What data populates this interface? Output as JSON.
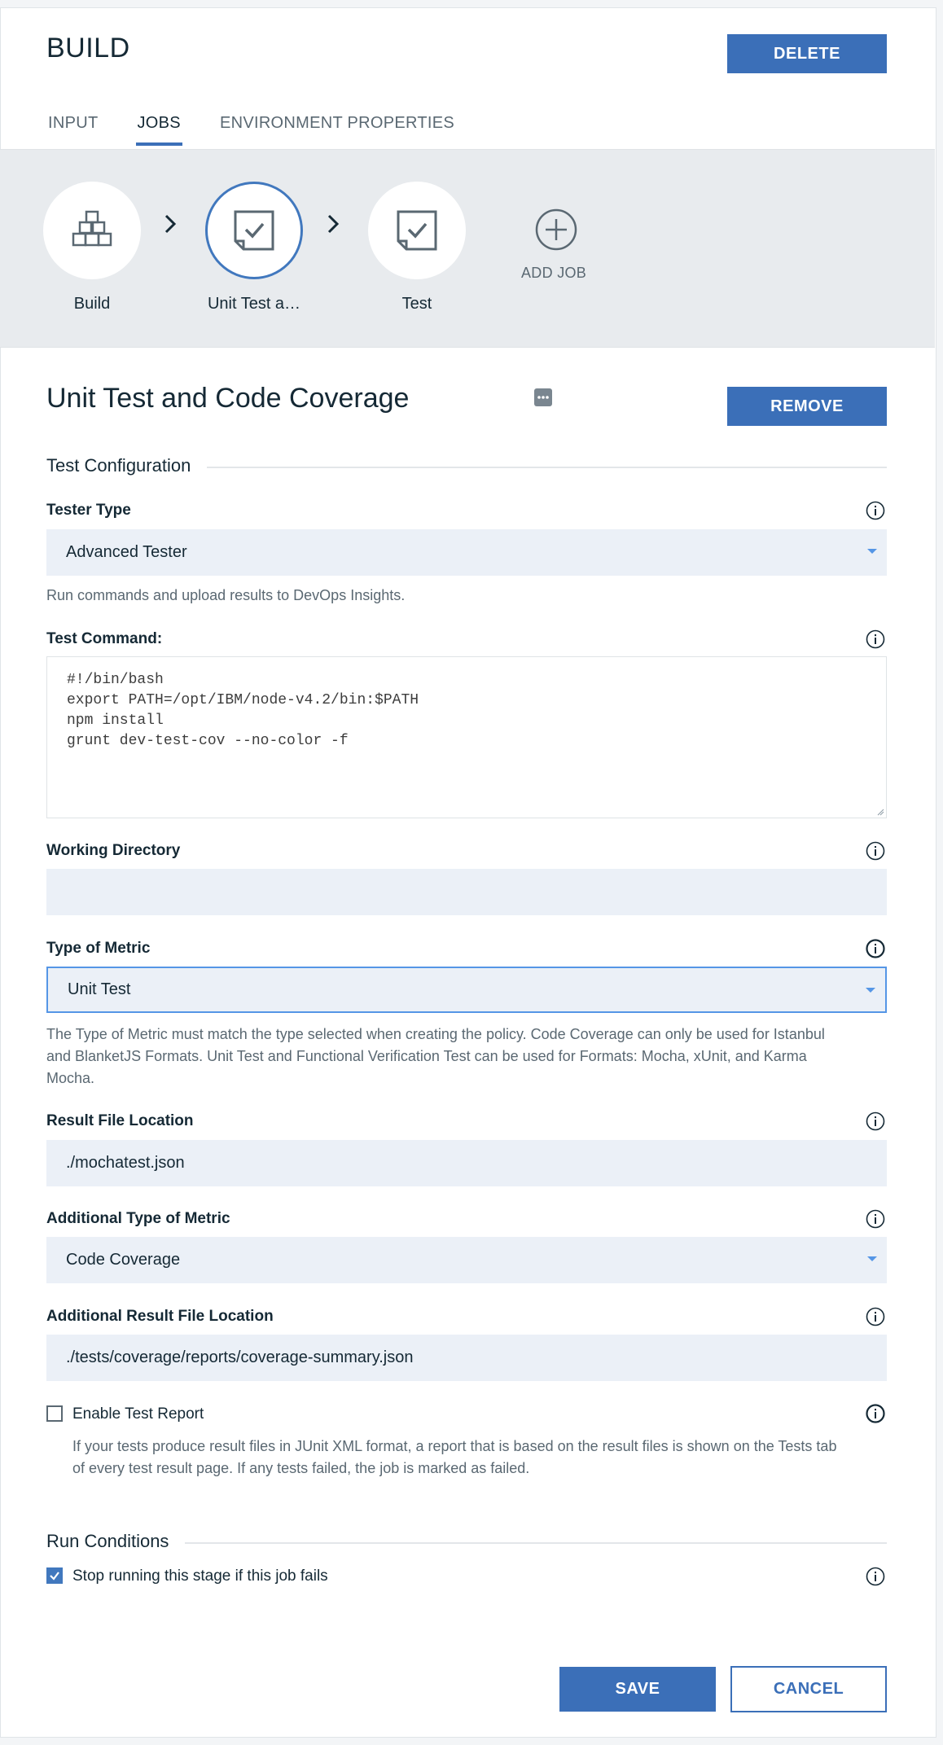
{
  "header": {
    "title": "BUILD",
    "delete_label": "DELETE",
    "tabs": [
      {
        "label": "INPUT",
        "active": false
      },
      {
        "label": "JOBS",
        "active": true
      },
      {
        "label": "ENVIRONMENT PROPERTIES",
        "active": false
      }
    ]
  },
  "pipeline": {
    "jobs": [
      {
        "label": "Build",
        "icon": "build-blocks-icon"
      },
      {
        "label": "Unit Test a…",
        "icon": "test-check-icon",
        "selected": true
      },
      {
        "label": "Test",
        "icon": "test-check-icon"
      }
    ],
    "add_job_label": "ADD JOB"
  },
  "job": {
    "title": "Unit Test and Code Coverage",
    "remove_label": "REMOVE"
  },
  "test_config": {
    "section_title": "Test Configuration",
    "tester_type": {
      "label": "Tester Type",
      "value": "Advanced Tester",
      "helper": "Run commands and upload results to DevOps Insights."
    },
    "test_command": {
      "label": "Test Command:",
      "lines": [
        "#!/bin/bash",
        "export PATH=/opt/IBM/node-v4.2/bin:$PATH",
        "npm install",
        "grunt dev-test-cov --no-color -f"
      ]
    },
    "working_directory": {
      "label": "Working Directory",
      "value": ""
    },
    "type_of_metric": {
      "label": "Type of Metric",
      "value": "Unit Test",
      "helper_line1": "The Type of Metric must match the type selected when creating the policy. Code Coverage can only be used for Istanbul",
      "helper_line2": "and BlanketJS Formats. Unit Test and Functional Verification Test can be used for Formats: Mocha, xUnit, and Karma",
      "helper_line3": "Mocha."
    },
    "result_file_location": {
      "label": "Result File Location",
      "value": "./mochatest.json"
    },
    "additional_type_of_metric": {
      "label": "Additional Type of Metric",
      "value": "Code Coverage"
    },
    "additional_result_file_location": {
      "label": "Additional Result File Location",
      "value": "./tests/coverage/reports/coverage-summary.json"
    },
    "enable_test_report": {
      "label": "Enable Test Report",
      "checked": false,
      "helper_line1": "If your tests produce result files in JUnit XML format, a report that is based on the result files is shown on the Tests tab",
      "helper_line2": "of every test result page. If any tests failed, the job is marked as failed."
    }
  },
  "run_conditions": {
    "section_title": "Run Conditions",
    "stop_on_fail": {
      "label": "Stop running this stage if this job fails",
      "checked": true
    }
  },
  "footer": {
    "save_label": "SAVE",
    "cancel_label": "CANCEL"
  },
  "colors": {
    "primary": "#3b6fb8",
    "selected_ring": "#4178be",
    "field_bg": "#ebf0f7",
    "pipeline_bg": "#e8ebee"
  }
}
